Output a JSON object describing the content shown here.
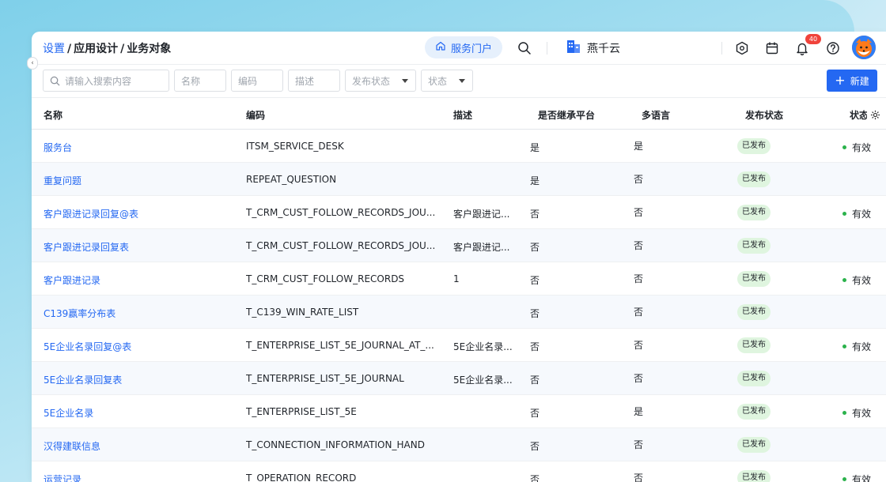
{
  "breadcrumb": {
    "root": "设置",
    "parent": "应用设计",
    "current": "业务对象"
  },
  "header": {
    "portal_label": "服务门户",
    "org_name": "燕千云",
    "notification_count": "40"
  },
  "filters": {
    "search_placeholder": "请输入搜索内容",
    "name_placeholder": "名称",
    "code_placeholder": "编码",
    "desc_placeholder": "描述",
    "publish_status_placeholder": "发布状态",
    "status_placeholder": "状态",
    "new_button": "新建"
  },
  "table": {
    "columns": [
      "名称",
      "编码",
      "描述",
      "是否继承平台",
      "多语言",
      "发布状态",
      "状态"
    ],
    "rows": [
      {
        "name": "服务台",
        "code": "ITSM_SERVICE_DESK",
        "desc": "",
        "inherit": "是",
        "multilang": "是",
        "publish": "已发布",
        "status": "有效"
      },
      {
        "name": "重复问题",
        "code": "REPEAT_QUESTION",
        "desc": "",
        "inherit": "是",
        "multilang": "否",
        "publish": "已发布",
        "status": ""
      },
      {
        "name": "客户跟进记录回复@表",
        "code": "T_CRM_CUST_FOLLOW_RECORDS_JOU...",
        "desc": "客户跟进记...",
        "inherit": "否",
        "multilang": "否",
        "publish": "已发布",
        "status": "有效"
      },
      {
        "name": "客户跟进记录回复表",
        "code": "T_CRM_CUST_FOLLOW_RECORDS_JOU...",
        "desc": "客户跟进记...",
        "inherit": "否",
        "multilang": "否",
        "publish": "已发布",
        "status": ""
      },
      {
        "name": "客户跟进记录",
        "code": "T_CRM_CUST_FOLLOW_RECORDS",
        "desc": "1",
        "inherit": "否",
        "multilang": "否",
        "publish": "已发布",
        "status": "有效"
      },
      {
        "name": "C139赢率分布表",
        "code": "T_C139_WIN_RATE_LIST",
        "desc": "",
        "inherit": "否",
        "multilang": "否",
        "publish": "已发布",
        "status": ""
      },
      {
        "name": "5E企业名录回复@表",
        "code": "T_ENTERPRISE_LIST_5E_JOURNAL_AT_...",
        "desc": "5E企业名录...",
        "inherit": "否",
        "multilang": "否",
        "publish": "已发布",
        "status": "有效"
      },
      {
        "name": "5E企业名录回复表",
        "code": "T_ENTERPRISE_LIST_5E_JOURNAL",
        "desc": "5E企业名录...",
        "inherit": "否",
        "multilang": "否",
        "publish": "已发布",
        "status": ""
      },
      {
        "name": "5E企业名录",
        "code": "T_ENTERPRISE_LIST_5E",
        "desc": "",
        "inherit": "否",
        "multilang": "是",
        "publish": "已发布",
        "status": "有效"
      },
      {
        "name": "汉得建联信息",
        "code": "T_CONNECTION_INFORMATION_HAND",
        "desc": "",
        "inherit": "否",
        "multilang": "否",
        "publish": "已发布",
        "status": ""
      },
      {
        "name": "运营记录",
        "code": "T_OPERATION_RECORD",
        "desc": "",
        "inherit": "否",
        "multilang": "否",
        "publish": "已发布",
        "status": "有效"
      }
    ]
  },
  "colors": {
    "accent": "#2468f2",
    "published_bg": "#dff5df",
    "valid_dot": "#2bb24c",
    "badge": "#f0433b"
  }
}
